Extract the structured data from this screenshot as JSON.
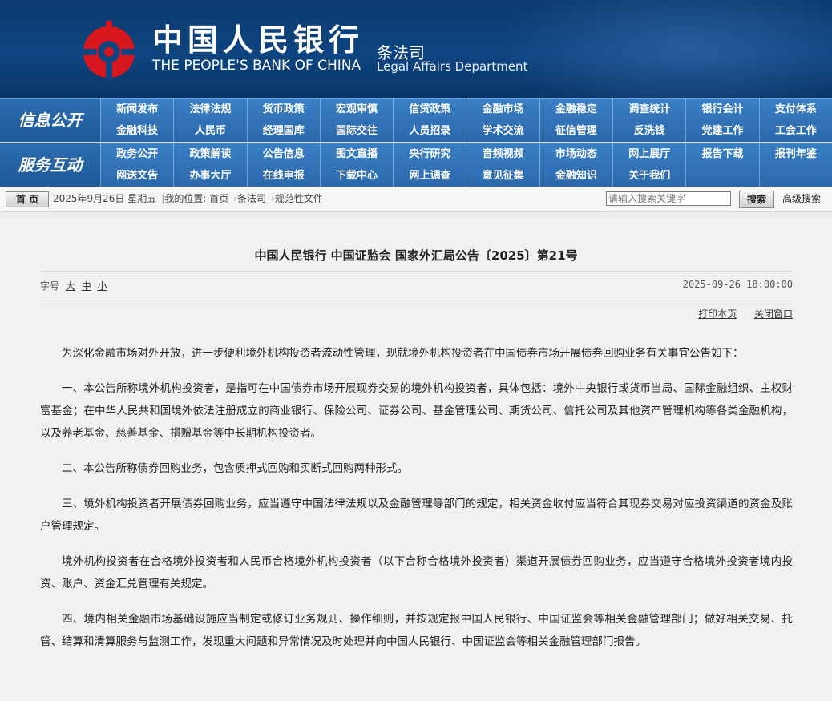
{
  "header": {
    "bank_name_cn": "中国人民银行",
    "bank_name_en": "THE PEOPLE'S BANK OF CHINA",
    "dept_cn": "条法司",
    "dept_en": "Legal Affairs Department",
    "brand_color": "#0e4580",
    "logo_color": "#d7161d"
  },
  "nav": {
    "info_label": "信息公开",
    "info_row1": [
      "新闻发布",
      "法律法规",
      "货币政策",
      "宏观审慎",
      "信贷政策",
      "金融市场",
      "金融稳定",
      "调查统计",
      "银行会计",
      "支付体系"
    ],
    "info_row2": [
      "金融科技",
      "人民币",
      "经理国库",
      "国际交往",
      "人员招录",
      "学术交流",
      "征信管理",
      "反洗钱",
      "党建工作",
      "工会工作"
    ],
    "service_label": "服务互动",
    "service_row1": [
      "政务公开",
      "政策解读",
      "公告信息",
      "图文直播",
      "央行研究",
      "音频视频",
      "市场动态",
      "网上展厅",
      "报告下载",
      "报刊年鉴"
    ],
    "service_row2": [
      "网送文告",
      "办事大厅",
      "在线申报",
      "下载中心",
      "网上调查",
      "意见征集",
      "金融知识",
      "关于我们"
    ]
  },
  "crumbbar": {
    "home": "首 页",
    "date": "2025年9月26日 星期五",
    "location_label": "我的位置:",
    "crumbs": [
      "首页",
      "条法司",
      "规范性文件"
    ],
    "search_placeholder": "请输入搜索关键字",
    "search_button": "搜索",
    "advanced": "高级搜索"
  },
  "article": {
    "title": "中国人民银行  中国证监会  国家外汇局公告〔2025〕第21号",
    "fontsize_label": "字号",
    "fontsize_large": "大",
    "fontsize_medium": "中",
    "fontsize_small": "小",
    "datetime": "2025-09-26 18:00:00",
    "print": "打印本页",
    "close": "关闭窗口",
    "paragraphs": [
      "为深化金融市场对外开放，进一步便利境外机构投资者流动性管理，现就境外机构投资者在中国债券市场开展债券回购业务有关事宜公告如下：",
      "一、本公告所称境外机构投资者，是指可在中国债券市场开展现券交易的境外机构投资者，具体包括：境外中央银行或货币当局、国际金融组织、主权财富基金；在中华人民共和国境外依法注册成立的商业银行、保险公司、证券公司、基金管理公司、期货公司、信托公司及其他资产管理机构等各类金融机构，以及养老基金、慈善基金、捐赠基金等中长期机构投资者。",
      "二、本公告所称债券回购业务，包含质押式回购和买断式回购两种形式。",
      "三、境外机构投资者开展债券回购业务，应当遵守中国法律法规以及金融管理等部门的规定，相关资金收付应当符合其现券交易对应投资渠道的资金及账户管理规定。",
      "境外机构投资者在合格境外投资者和人民币合格境外机构投资者（以下合称合格境外投资者）渠道开展债券回购业务，应当遵守合格境外投资者境内投资、账户、资金汇兑管理有关规定。",
      "四、境内相关金融市场基础设施应当制定或修订业务规则、操作细则，并按规定报中国人民银行、中国证监会等相关金融管理部门；做好相关交易、托管、结算和清算服务与监测工作，发现重大问题和异常情况及时处理并向中国人民银行、中国证监会等相关金融管理部门报告。"
    ]
  }
}
